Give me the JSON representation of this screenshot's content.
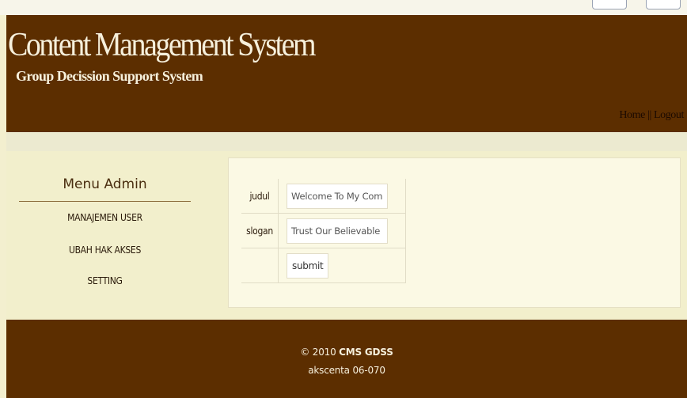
{
  "header": {
    "title": "Content Management System",
    "subtitle": "Group Decission Support System",
    "nav_home": "Home",
    "nav_separator": " || ",
    "nav_logout": "Logout"
  },
  "sidebar": {
    "title": "Menu Admin",
    "items": [
      {
        "label": "MANAJEMEN USER"
      },
      {
        "label": "UBAH HAK AKSES"
      },
      {
        "label": "SETTING"
      }
    ]
  },
  "form": {
    "judul_label": "judul",
    "judul_value": "Welcome To My Compa",
    "slogan_label": "slogan",
    "slogan_value": "Trust Our Believable",
    "submit_label": "submit"
  },
  "footer": {
    "copyright_prefix": "© 2010 ",
    "copyright_brand": "CMS GDSS",
    "credit": "akscenta 06-070"
  },
  "colors": {
    "brand_brown": "#5c2e00",
    "cream_background": "#f3efcf",
    "content_panel": "#fbf9e4"
  }
}
